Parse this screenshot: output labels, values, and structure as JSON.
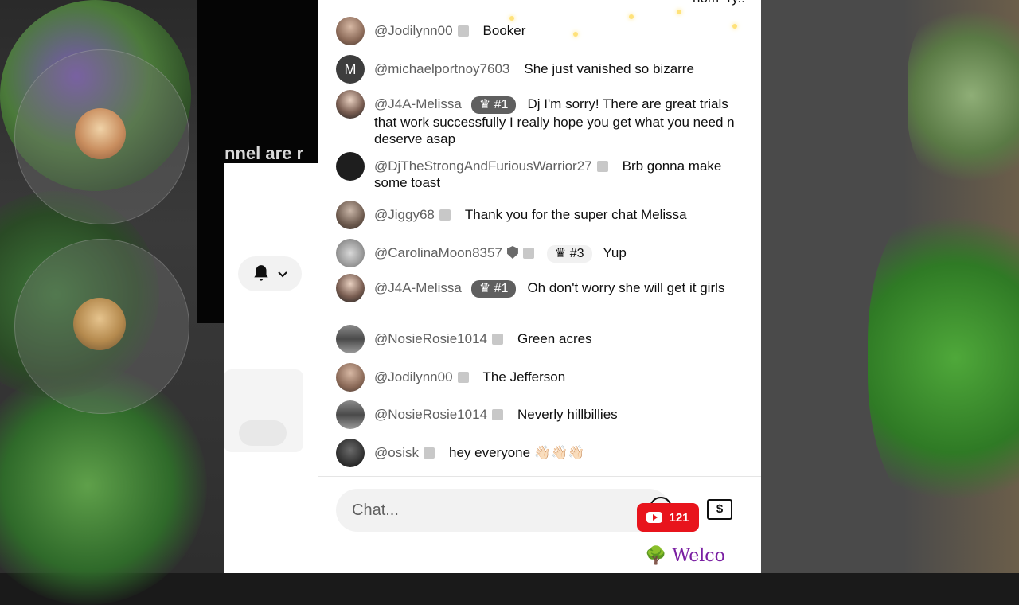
{
  "overlay": {
    "channel_text": "nnel are r",
    "viewer_count": "121",
    "welcome_text": "🌳 Welco"
  },
  "chat": {
    "top_cut_text": "nom- ry..",
    "input_placeholder": "Chat...",
    "superchat_symbol": "$",
    "messages": [
      {
        "author": "@Jodilynn00",
        "rank": "",
        "text": "Booker",
        "mod": false
      },
      {
        "author": "@michaelportnoy7603",
        "avatar_letter": "M",
        "rank": "",
        "text": "She just vanished so bizarre",
        "mod": false
      },
      {
        "author": "@J4A-Melissa",
        "rank": "#1",
        "text": "Dj I'm sorry! There are great trials that work successfully I really hope you get what you need n deserve asap",
        "mod": false
      },
      {
        "author": "@DjTheStrongAndFuriousWarrior27",
        "rank": "",
        "text": "Brb gonna make some toast",
        "mod": false
      },
      {
        "author": "@Jiggy68",
        "rank": "",
        "text": "Thank you for the super chat Melissa",
        "mod": false
      },
      {
        "author": "@CarolinaMoon8357",
        "rank": "#3",
        "text": "Yup",
        "mod": true
      },
      {
        "author": "@J4A-Melissa",
        "rank": "#1",
        "text": "Oh don't worry she will get it girls",
        "mod": false
      },
      {
        "author": "@NosieRosie1014",
        "rank": "",
        "text": "Green acres",
        "mod": false
      },
      {
        "author": "@Jodilynn00",
        "rank": "",
        "text": "The Jefferson",
        "mod": false
      },
      {
        "author": "@NosieRosie1014",
        "rank": "",
        "text": "Neverly hillbillies",
        "mod": false
      },
      {
        "author": "@osisk",
        "rank": "",
        "text": "hey everyone 👋🏻👋🏻👋🏻",
        "mod": false
      }
    ]
  },
  "colors": {
    "youtube_red": "#e8141c",
    "welcome_purple": "#7a1fa2",
    "rank_badge": "#5f5f5f"
  }
}
